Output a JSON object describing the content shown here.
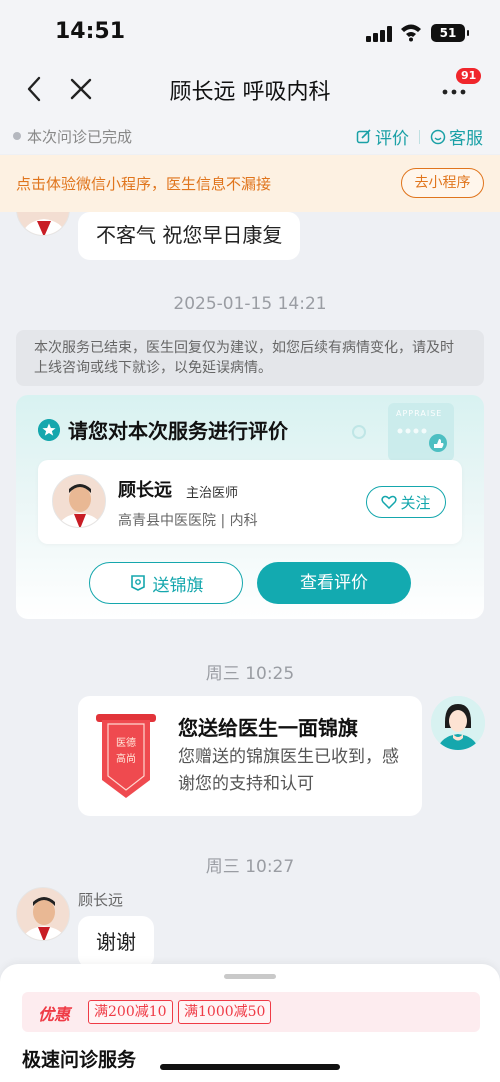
{
  "status_bar": {
    "time": "14:51",
    "battery": "51"
  },
  "nav": {
    "title": "顾长远 呼吸内科",
    "badge": "91",
    "icons": [
      "back-icon",
      "close-icon",
      "more-icon"
    ]
  },
  "consult": {
    "status": "本次问诊已完成",
    "evaluate": "评价",
    "service": "客服"
  },
  "banner": {
    "text": "点击体验微信小程序，医生信息不漏接",
    "button": "去小程序"
  },
  "messages": {
    "doctor_reply_1": "不客气  祝您早日康复",
    "time_1": "2025-01-15 14:21",
    "system_notice": "本次服务已结束，医生回复仅为建议，如您后续有病情变化，请及时上线咨询或线下就诊，以免延误病情。",
    "eval_card": {
      "title": "请您对本次服务进行评价",
      "deco_caption": "APPRAISE",
      "doctor_name": "顾长远",
      "doctor_level": "主治医师",
      "hospital": "高青县中医医院 | 内科",
      "follow": "关注",
      "send_flag": "送锦旗",
      "view_eval": "查看评价"
    },
    "time_2": "周三 10:25",
    "flag_card": {
      "title": "您送给医生一面锦旗",
      "desc": "您赠送的锦旗医生已收到，感谢您的支持和认可",
      "flag_text": "医德高尚"
    },
    "time_3": "周三 10:27",
    "doctor_sender": "顾长远",
    "doctor_reply_2": "谢谢"
  },
  "sheet": {
    "promo_label": "优惠",
    "coupons": [
      "满200减10",
      "满1000减50"
    ],
    "title": "极速问诊服务"
  },
  "colors": {
    "accent": "#15a7ad",
    "banner_text": "#e0751d",
    "promo_red": "#ef3b46",
    "badge_red": "#f0262c"
  }
}
